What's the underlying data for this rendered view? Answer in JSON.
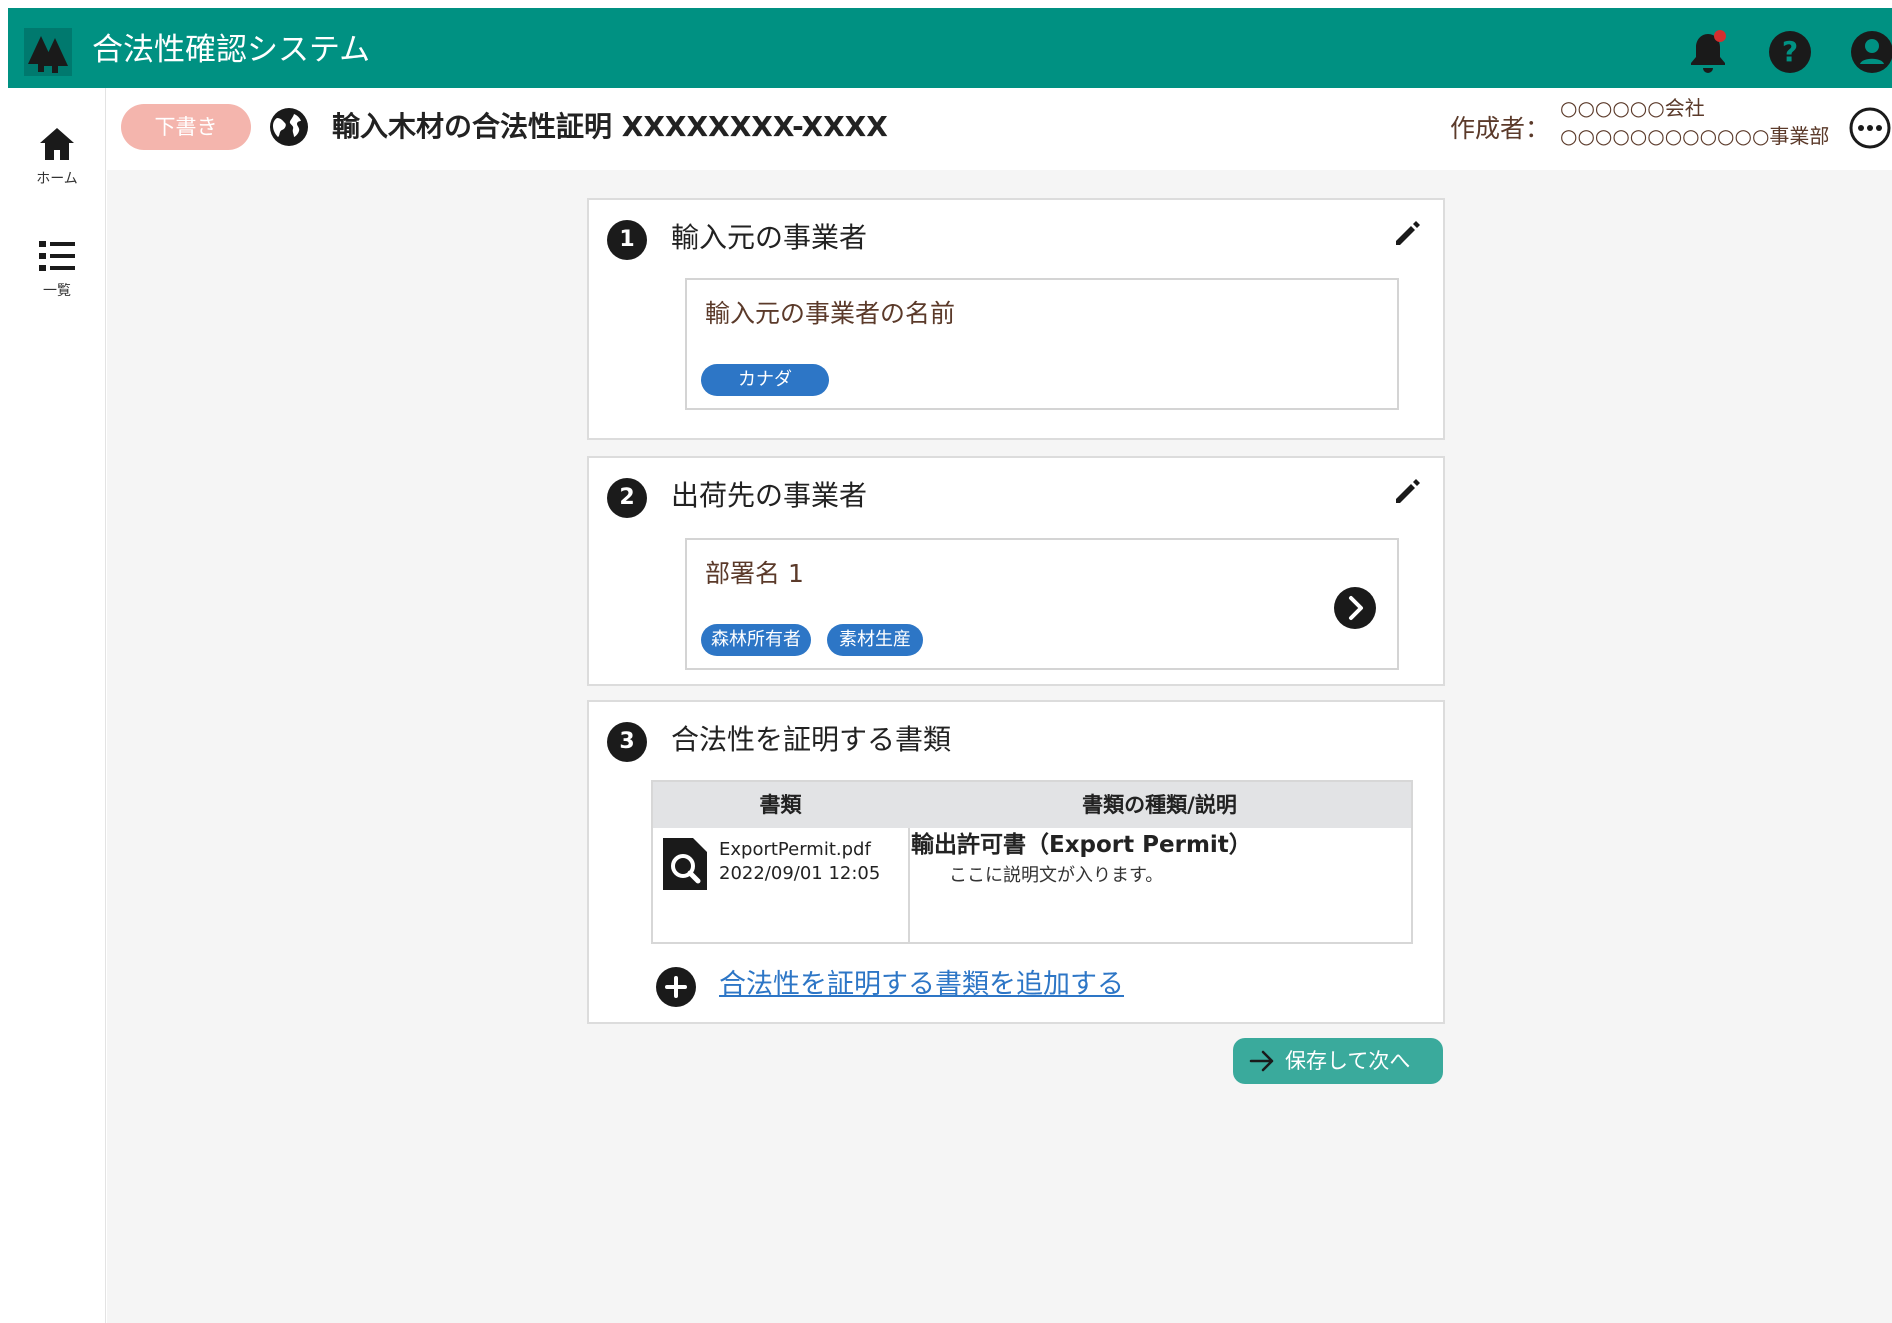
{
  "app": {
    "title": "合法性確認システム",
    "brand_color": "#009182",
    "icons": [
      "forest-logo-icon",
      "bell-icon",
      "help-icon",
      "account-icon"
    ]
  },
  "sidebar": {
    "items": [
      {
        "label": "ホーム",
        "icon": "home-icon"
      },
      {
        "label": "一覧",
        "icon": "list-icon"
      }
    ]
  },
  "subheader": {
    "status": "下書き",
    "status_color": "#f4b5ad",
    "title": "輸入木材の合法性証明 XXXXXXXX-XXXX",
    "author_label": "作成者：",
    "author_company": "○○○○○○会社",
    "author_department": "○○○○○○○○○○○○事業部"
  },
  "sections": [
    {
      "number": "1",
      "title": "輸入元の事業者",
      "card": {
        "name": "輸入元の事業者の名前",
        "tags": [
          "カナダ"
        ]
      }
    },
    {
      "number": "2",
      "title": "出荷先の事業者",
      "card": {
        "name": "部署名 1",
        "tags": [
          "森林所有者",
          "素材生産"
        ]
      }
    },
    {
      "number": "3",
      "title": "合法性を証明する書類",
      "table": {
        "headers": [
          "書類",
          "書類の種類/説明"
        ],
        "rows": [
          {
            "file_name": "ExportPermit.pdf",
            "file_date": "2022/09/01 12:05",
            "kind": "輸出許可書（Export Permit）",
            "description": "ここに説明文が入ります。"
          }
        ]
      },
      "add_link": "合法性を証明する書類を追加する"
    }
  ],
  "actions": {
    "save_next": "保存して次へ",
    "accent_color": "#3aaa9c",
    "tag_color": "#2d76c6"
  }
}
